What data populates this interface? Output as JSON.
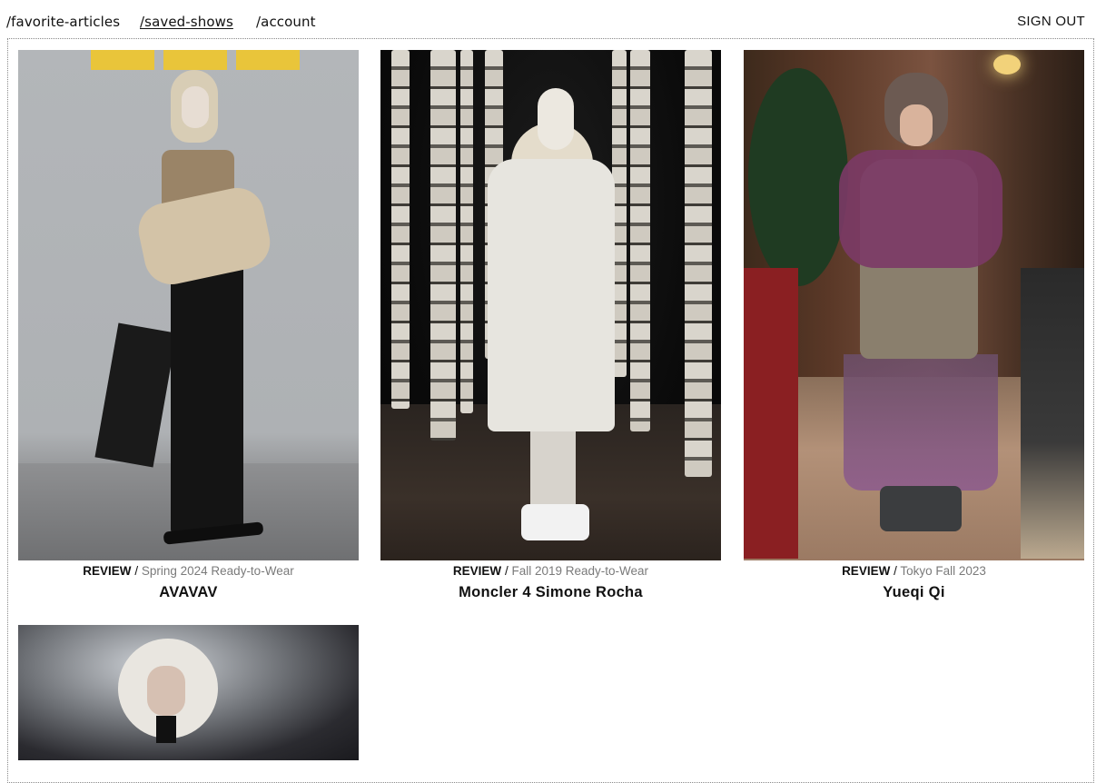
{
  "nav": {
    "links": [
      "/favorite-articles",
      "/saved-shows",
      "/account"
    ],
    "active_index": 1,
    "sign_out": "SIGN OUT"
  },
  "shows": [
    {
      "kind": "REVIEW",
      "sep": "/",
      "season": "Spring 2024 Ready-to-Wear",
      "designer": "AVAVAV"
    },
    {
      "kind": "REVIEW",
      "sep": "/",
      "season": "Fall 2019 Ready-to-Wear",
      "designer": "Moncler 4 Simone Rocha"
    },
    {
      "kind": "REVIEW",
      "sep": "/",
      "season": "Tokyo Fall 2023",
      "designer": "Yueqi Qi"
    }
  ],
  "colors": {
    "muted": "#7a7a7a",
    "text": "#111111",
    "border": "#8a8a8a"
  }
}
